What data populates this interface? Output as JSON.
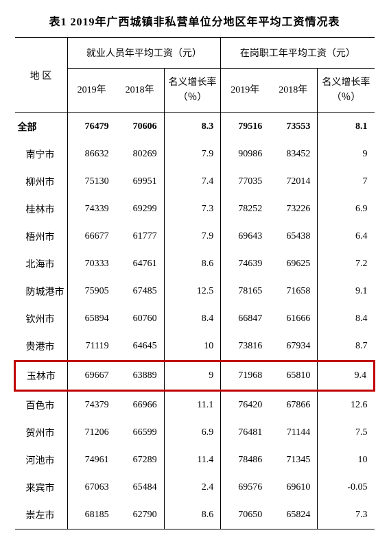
{
  "title": "表1  2019年广西城镇非私营单位分地区年平均工资情况表",
  "header": {
    "region": "地  区",
    "group1": "就业人员年平均工资（元）",
    "group2": "在岗职工年平均工资（元）",
    "cols": {
      "y1": "2019年",
      "y2": "2018年",
      "rate": "名义增长率（％）"
    }
  },
  "chart_data": {
    "type": "table",
    "title": "2019年广西城镇非私营单位分地区年平均工资情况表",
    "columns": [
      "地区",
      "就业人员年平均工资2019年(元)",
      "就业人员年平均工资2018年(元)",
      "就业人员名义增长率(%)",
      "在岗职工年平均工资2019年(元)",
      "在岗职工年平均工资2018年(元)",
      "在岗职工名义增长率(%)"
    ],
    "highlight_region": "玉林市",
    "rows": [
      {
        "region": "全部",
        "a1": 76479,
        "a2": 70606,
        "ar": 8.3,
        "b1": 79516,
        "b2": 73553,
        "br": 8.1,
        "total": true
      },
      {
        "region": "南宁市",
        "a1": 86632,
        "a2": 80269,
        "ar": 7.9,
        "b1": 90986,
        "b2": 83452,
        "br": 9
      },
      {
        "region": "柳州市",
        "a1": 75130,
        "a2": 69951,
        "ar": 7.4,
        "b1": 77035,
        "b2": 72014,
        "br": 7
      },
      {
        "region": "桂林市",
        "a1": 74339,
        "a2": 69299,
        "ar": 7.3,
        "b1": 78252,
        "b2": 73226,
        "br": 6.9
      },
      {
        "region": "梧州市",
        "a1": 66677,
        "a2": 61777,
        "ar": 7.9,
        "b1": 69643,
        "b2": 65438,
        "br": 6.4
      },
      {
        "region": "北海市",
        "a1": 70333,
        "a2": 64761,
        "ar": 8.6,
        "b1": 74639,
        "b2": 69625,
        "br": 7.2
      },
      {
        "region": "防城港市",
        "a1": 75905,
        "a2": 67485,
        "ar": 12.5,
        "b1": 78165,
        "b2": 71658,
        "br": 9.1
      },
      {
        "region": "钦州市",
        "a1": 65894,
        "a2": 60760,
        "ar": 8.4,
        "b1": 66847,
        "b2": 61666,
        "br": 8.4
      },
      {
        "region": "贵港市",
        "a1": 71119,
        "a2": 64645,
        "ar": 10,
        "b1": 73816,
        "b2": 67934,
        "br": 8.7
      },
      {
        "region": "玉林市",
        "a1": 69667,
        "a2": 63889,
        "ar": 9,
        "b1": 71968,
        "b2": 65810,
        "br": 9.4,
        "highlight": true
      },
      {
        "region": "百色市",
        "a1": 74379,
        "a2": 66966,
        "ar": 11.1,
        "b1": 76420,
        "b2": 67866,
        "br": 12.6
      },
      {
        "region": "贺州市",
        "a1": 71206,
        "a2": 66599,
        "ar": 6.9,
        "b1": 76481,
        "b2": 71144,
        "br": 7.5
      },
      {
        "region": "河池市",
        "a1": 74961,
        "a2": 67289,
        "ar": 11.4,
        "b1": 78486,
        "b2": 71345,
        "br": 10
      },
      {
        "region": "来宾市",
        "a1": 67063,
        "a2": 65484,
        "ar": 2.4,
        "b1": 69576,
        "b2": 69610,
        "br": -0.05
      },
      {
        "region": "崇左市",
        "a1": 68185,
        "a2": 62790,
        "ar": 8.6,
        "b1": 70650,
        "b2": 65824,
        "br": 7.3
      }
    ]
  }
}
